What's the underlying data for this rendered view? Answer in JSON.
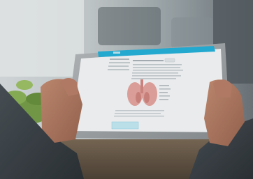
{
  "scene": {
    "description_free": true
  },
  "tablet": {
    "app_brand": "",
    "nav_items": [
      "",
      "",
      "",
      ""
    ],
    "sidebar_items": [
      "",
      "",
      "",
      ""
    ]
  }
}
